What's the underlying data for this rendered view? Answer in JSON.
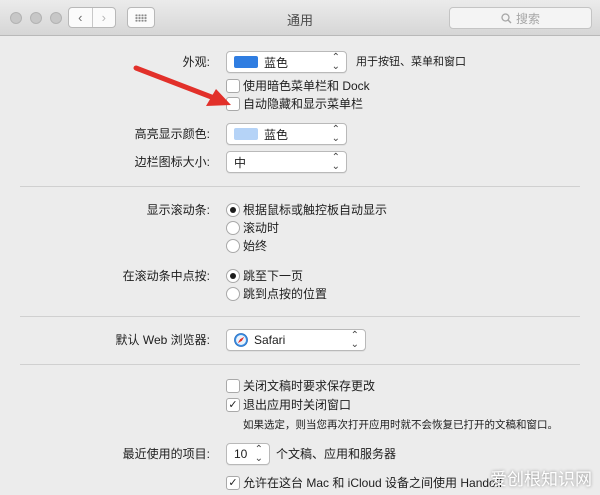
{
  "window": {
    "title": "通用"
  },
  "toolbar": {
    "search_placeholder": "搜索"
  },
  "appearance": {
    "label": "外观:",
    "value": "蓝色",
    "accent_color": "#2f7de1",
    "hint": "用于按钮、菜单和窗口",
    "dark_menu_label": "使用暗色菜单栏和 Dock",
    "dark_menu_checked": false,
    "auto_hide_label": "自动隐藏和显示菜单栏",
    "auto_hide_checked": false
  },
  "highlight": {
    "label": "高亮显示颜色:",
    "value": "蓝色",
    "color": "#b5d3f7"
  },
  "sidebar_icon": {
    "label": "边栏图标大小:",
    "value": "中"
  },
  "scrollbars": {
    "label": "显示滚动条:",
    "options": [
      "根据鼠标或触控板自动显示",
      "滚动时",
      "始终"
    ],
    "selected_index": 0
  },
  "click_scroll": {
    "label": "在滚动条中点按:",
    "options": [
      "跳至下一页",
      "跳到点按的位置"
    ],
    "selected_index": 0
  },
  "browser": {
    "label": "默认 Web 浏览器:",
    "value": "Safari"
  },
  "documents": {
    "ask_save_label": "关闭文稿时要求保存更改",
    "ask_save_checked": false,
    "close_windows_label": "退出应用时关闭窗口",
    "close_windows_checked": true,
    "note": "如果选定，则当您再次打开应用时就不会恢复已打开的文稿和窗口。"
  },
  "recent_items": {
    "label": "最近使用的项目:",
    "value": "10",
    "suffix": "个文稿、应用和服务器"
  },
  "handoff": {
    "label": "允许在这台 Mac 和 iCloud 设备之间使用 Handoff",
    "checked": true
  },
  "watermark": {
    "text": "爱创根知识网"
  },
  "annotation_color": "#e2302a"
}
